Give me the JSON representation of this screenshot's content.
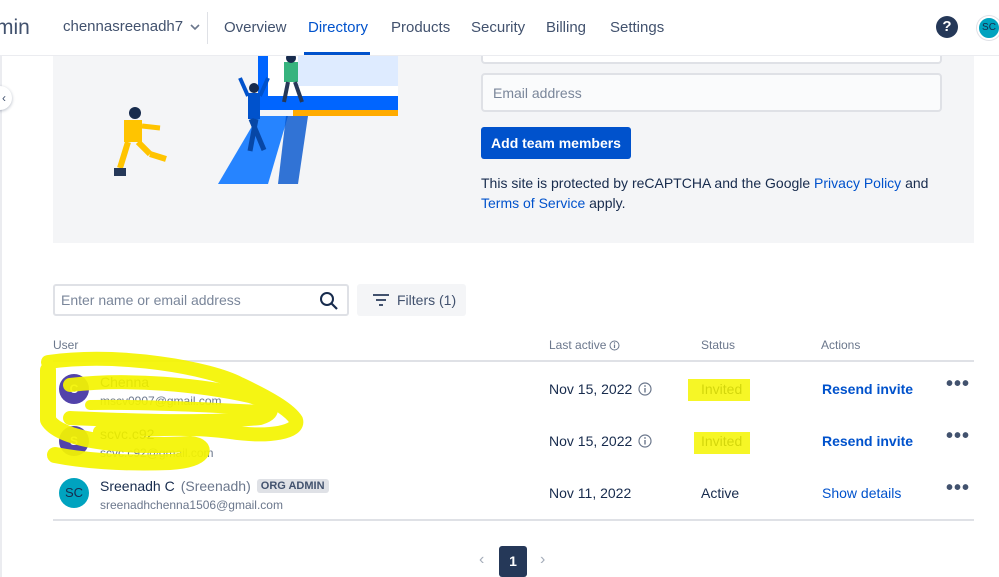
{
  "nav": {
    "app_title": "min",
    "org_name": "chennasreenadh7",
    "tabs": [
      {
        "label": "Overview"
      },
      {
        "label": "Directory"
      },
      {
        "label": "Products"
      },
      {
        "label": "Security"
      },
      {
        "label": "Billing"
      },
      {
        "label": "Settings"
      }
    ],
    "active_tab": "Directory",
    "help_label": "?",
    "user_initials": "SC"
  },
  "invite": {
    "email_placeholder": "Email address",
    "add_button": "Add team members",
    "recaptcha_prefix": "This site is protected by reCAPTCHA and the Google ",
    "privacy_link": "Privacy Policy",
    "and_text": " and ",
    "terms_link": "Terms of Service",
    "suffix": " apply."
  },
  "search": {
    "placeholder": "Enter name or email address"
  },
  "filters": {
    "label": "Filters (1)"
  },
  "table": {
    "columns": {
      "user": "User",
      "last_active": "Last active",
      "status": "Status",
      "actions": "Actions"
    },
    "rows": [
      {
        "initial": "C",
        "name": "Chenna",
        "alias": "",
        "badge": "",
        "email": "mscv0907@gmail.com",
        "last_active": "Nov 15, 2022",
        "status": "Invited",
        "action": "Resend invite",
        "avatar_color": "#5243aa"
      },
      {
        "initial": "S",
        "name": "scvc.c92",
        "alias": "",
        "badge": "",
        "email": "scvc.c92@gmail.com",
        "last_active": "Nov 15, 2022",
        "status": "Invited",
        "action": "Resend invite",
        "avatar_color": "#5243aa"
      },
      {
        "initial": "SC",
        "name": "Sreenadh C",
        "alias": "(Sreenadh)",
        "badge": "ORG ADMIN",
        "email": "sreenadhchenna1506@gmail.com",
        "last_active": "Nov 11, 2022",
        "status": "Active",
        "action": "Show details",
        "avatar_color": "#00a3bf"
      }
    ]
  },
  "pagination": {
    "prev": "‹",
    "current": "1",
    "next": "›"
  },
  "colors": {
    "primary": "#0052cc",
    "highlighter": "#f5f500"
  }
}
